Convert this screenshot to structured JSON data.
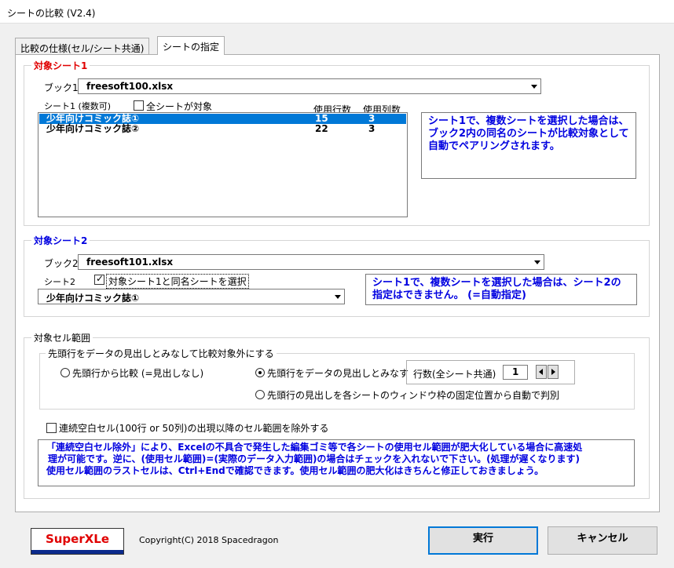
{
  "window": {
    "title": "シートの比較 (V2.4)"
  },
  "tabs": [
    {
      "label": "比較の仕様(セル/シート共通)"
    },
    {
      "label": "シートの指定"
    }
  ],
  "sheet1": {
    "legend": "対象シート1",
    "book_label": "ブック1",
    "book_value": "freesoft100.xlsx",
    "sheets_label": "シート1 (複数可)",
    "all_sheets_label": "全シートが対象",
    "all_sheets_checked": false,
    "col_rows": "使用行数",
    "col_cols": "使用列数",
    "rows": [
      {
        "name": "少年向けコミック誌①",
        "used_rows": "15",
        "used_cols": "3",
        "selected": true
      },
      {
        "name": "少年向けコミック誌②",
        "used_rows": "22",
        "used_cols": "3",
        "selected": false
      }
    ],
    "info": "シート1で、複数シートを選択した場合は、ブック2内の同名のシートが比較対象として自動でペアリングされます。"
  },
  "sheet2": {
    "legend": "対象シート2",
    "book_label": "ブック2",
    "book_value": "freesoft101.xlsx",
    "sheet_label": "シート2",
    "same_name_label": "対象シート1と同名シートを選択",
    "same_name_checked": true,
    "sheet_value": "少年向けコミック誌①",
    "info": "シート1で、複数シートを選択した場合は、シート2の指定はできません。 (=自動指定)"
  },
  "cellrange": {
    "legend": "対象セル範囲",
    "header_group_legend": "先頭行をデータの見出しとみなして比較対象外にする",
    "radio_compare_from_first": "先頭行から比較 (=見出しなし)",
    "radio_first_row_header": "先頭行をデータの見出しとみなす",
    "radio_auto_freeze": "先頭行の見出しを各シートのウィンドウ枠の固定位置から自動で判別",
    "selected_radio": "first_row_header",
    "rowcount_label": "行数(全シート共通)",
    "rowcount_value": "1",
    "exclude_blank_label": "連続空白セル(100行 or 50列)の出現以降のセル範囲を除外する",
    "exclude_blank_checked": false,
    "info_line1": "「連続空白セル除外」により、Excelの不具合で発生した編集ゴミ等で各シートの使用セル範囲が肥大化している場合に高速処",
    "info_line2": "理が可能です。逆に、(使用セル範囲)=(実際のデータ入力範囲)の場合はチェックを入れないで下さい。(処理が遅くなります)",
    "info_line3": "使用セル範囲のラストセルは、Ctrl+Endで確認できます。使用セル範囲の肥大化はきちんと修正しておきましょう。"
  },
  "footer": {
    "logo": "SuperXLe",
    "copyright": "Copyright(C) 2018 Spacedragon",
    "run_label": "実行",
    "cancel_label": "キャンセル"
  },
  "colors": {
    "accent_blue": "#0000e0",
    "accent_red": "#e00000",
    "selection": "#0078d7"
  }
}
